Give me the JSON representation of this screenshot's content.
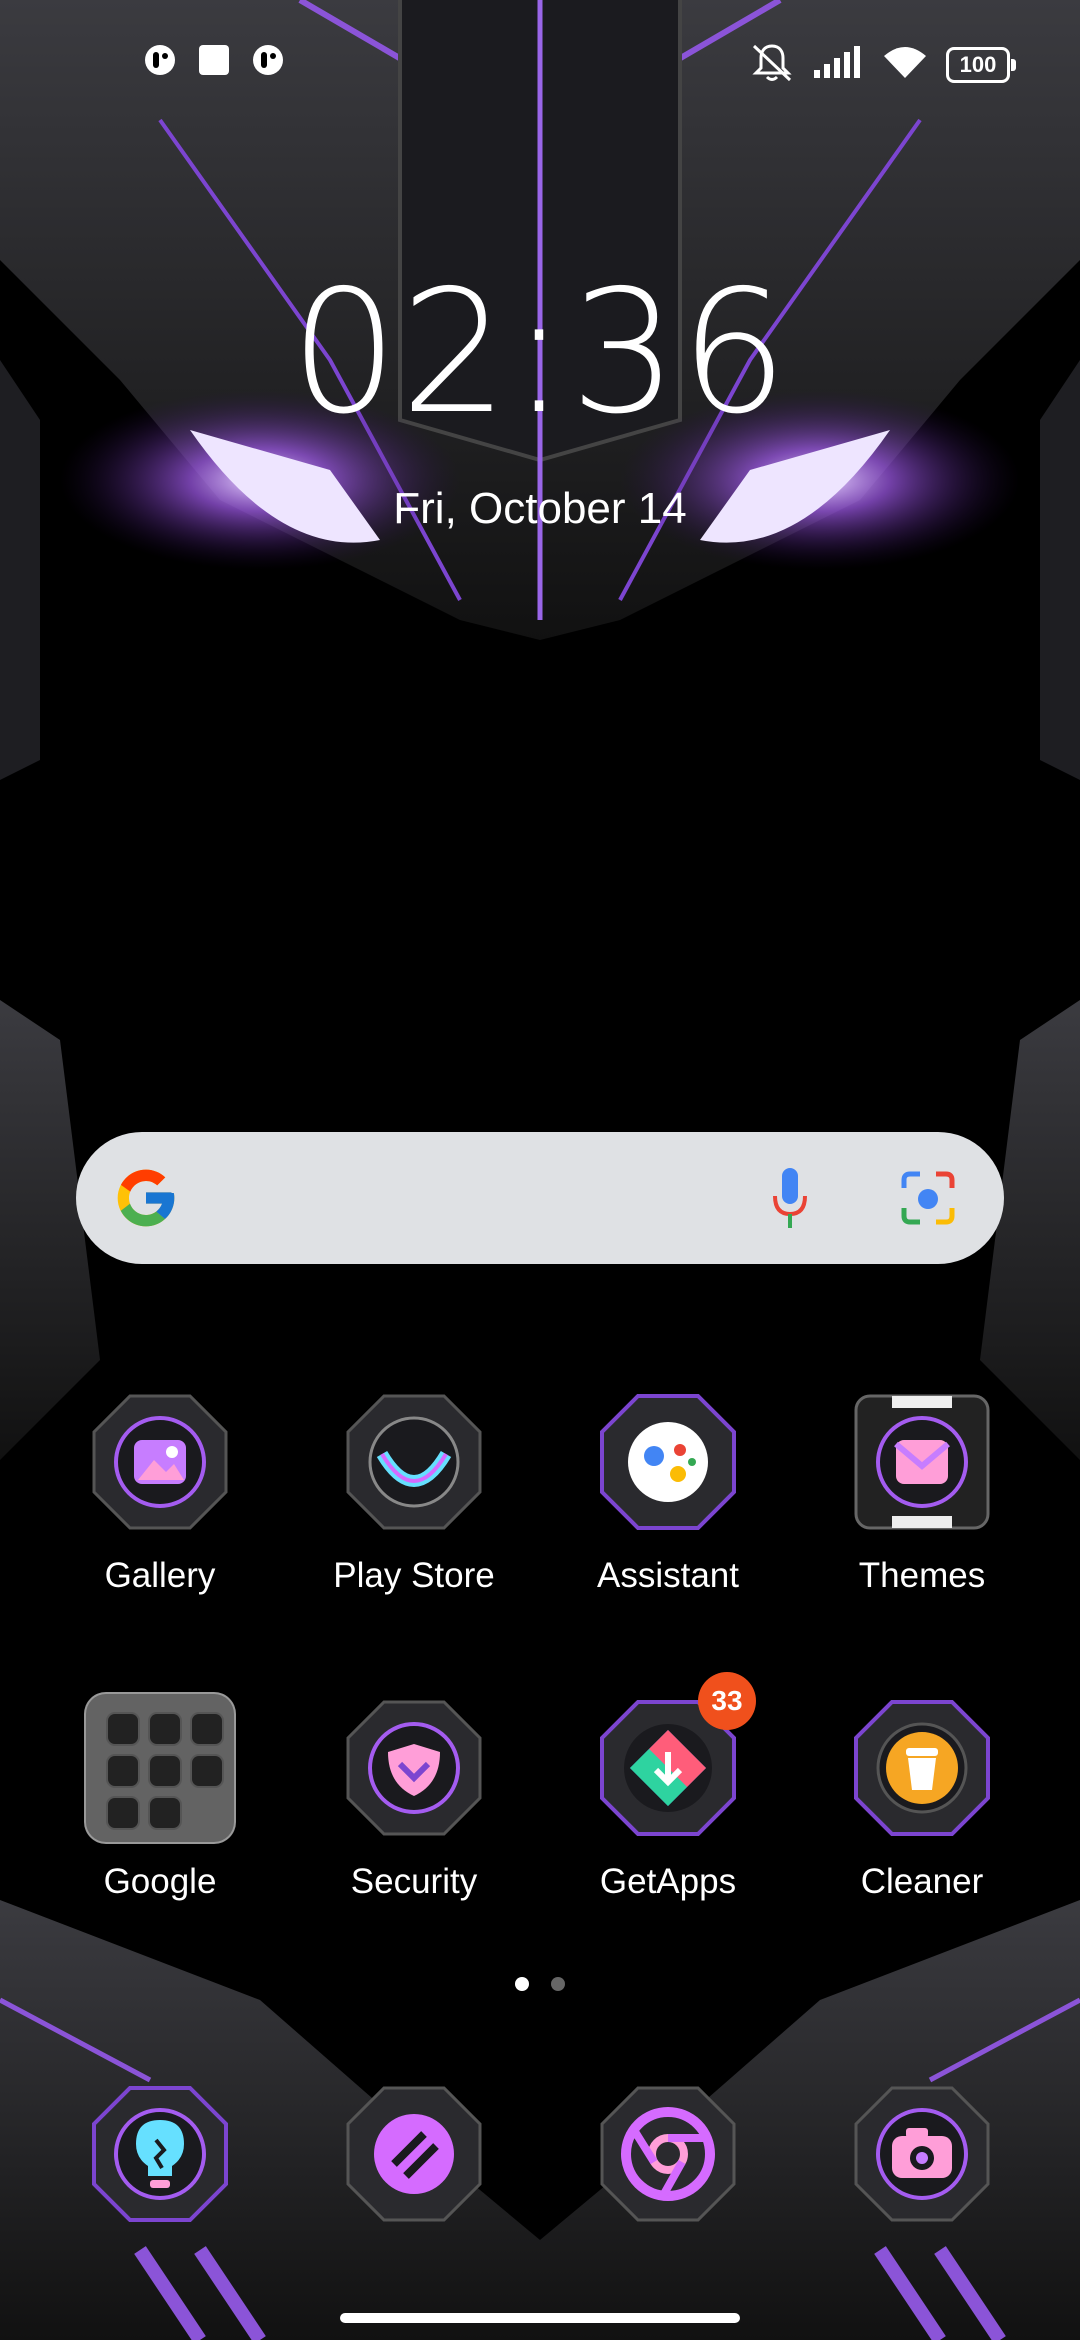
{
  "status_bar": {
    "battery": "100",
    "icons": [
      "notification-app-icon",
      "screen-record-icon",
      "notification-app-icon",
      "silent-bell-icon",
      "signal-icon",
      "wifi-icon",
      "battery-icon"
    ]
  },
  "clock": {
    "time": "02:36",
    "date": "Fri, October 14"
  },
  "search_bar": {
    "icons": [
      "google-g-icon",
      "mic-icon",
      "lens-camera-icon"
    ]
  },
  "apps": [
    {
      "label": "Gallery",
      "icon": "gallery-icon"
    },
    {
      "label": "Play Store",
      "icon": "play-store-icon"
    },
    {
      "label": "Assistant",
      "icon": "assistant-icon"
    },
    {
      "label": "Themes",
      "icon": "themes-icon"
    },
    {
      "label": "Google",
      "icon": "google-folder-icon"
    },
    {
      "label": "Security",
      "icon": "security-icon"
    },
    {
      "label": "GetApps",
      "icon": "getapps-icon",
      "badge": "33"
    },
    {
      "label": "Cleaner",
      "icon": "cleaner-icon"
    }
  ],
  "page_indicator": {
    "current": 1,
    "total": 2
  },
  "dock": [
    {
      "icon": "tips-bulb-icon"
    },
    {
      "icon": "notes-icon"
    },
    {
      "icon": "chrome-icon"
    },
    {
      "icon": "camera-icon"
    }
  ],
  "colors": {
    "accent_purple": "#a45cf0",
    "badge": "#f0501c",
    "search_bg": "#dfe1e4"
  }
}
